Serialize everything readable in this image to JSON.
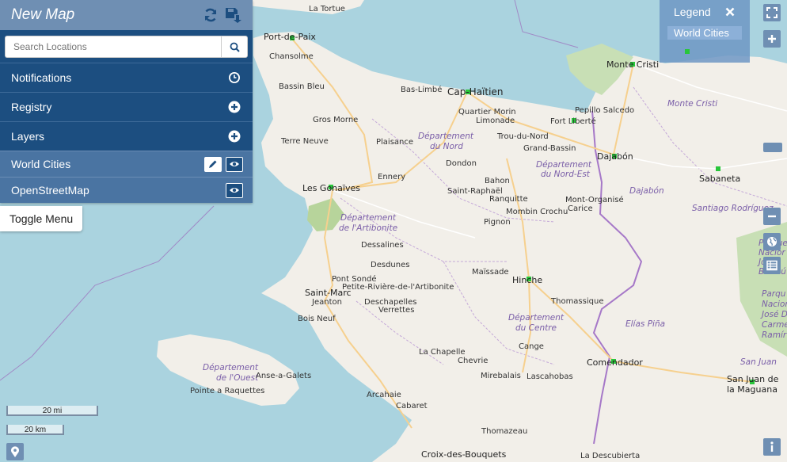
{
  "panel": {
    "title": "New Map",
    "search_placeholder": "Search Locations",
    "menu": [
      {
        "label": "Notifications",
        "icon": "clock-icon"
      },
      {
        "label": "Registry",
        "icon": "plus-circle-icon"
      },
      {
        "label": "Layers",
        "icon": "plus-circle-icon"
      }
    ],
    "layers": [
      {
        "label": "World Cities",
        "icons": [
          "pencil-icon",
          "eye-icon"
        ]
      },
      {
        "label": "OpenStreetMap",
        "icons": [
          "eye-icon"
        ]
      }
    ],
    "toggle_menu": "Toggle Menu"
  },
  "legend": {
    "title": "Legend",
    "layer": "World Cities",
    "swatch_color": "#28c63a"
  },
  "scale": {
    "miles": "20 mi",
    "km": "20 km"
  },
  "colors": {
    "water": "#aad3df",
    "land": "#f2efe9",
    "panel": "#1c4e80",
    "panel_header": "#6f8fb3",
    "layer_row": "#4a74a2",
    "city_marker": "#28c63a"
  },
  "map_labels": {
    "la_tortue": "La Tortue",
    "port_de_paix": "Port-de-Paix",
    "chansolme": "Chansolme",
    "bassin_bleu": "Bassin Bleu",
    "bas_limbe": "Bas-Limbé",
    "cap_haitien": "Cap-Haïtien",
    "monte_cristi_city": "Monte Cristi",
    "monte_cristi_prov": "Monte Cristi",
    "quartier_morin": "Quartier Morin",
    "limonade": "Limonade",
    "pepillo_salcedo": "Pepillo Salcedo",
    "gros_morne": "Gros Morne",
    "dept_nord_1": "Département",
    "dept_nord_2": "du Nord",
    "trou_du_nord": "Trou-du-Nord",
    "fort_liberte": "Fort Liberté",
    "terre_neuve": "Terre Neuve",
    "plaisance": "Plaisance",
    "grand_bassin": "Grand-Bassin",
    "dajabon": "Dajabón",
    "dondon": "Dondon",
    "dept_ne_1": "Département",
    "dept_ne_2": "du Nord-Est",
    "sabaneta": "Sabaneta",
    "ennery": "Ennery",
    "bahon": "Bahon",
    "les_gonaives": "Les Gonaïves",
    "saint_raphael": "Saint-Raphaël",
    "dajabon_prov": "Dajabón",
    "ranquitte": "Ranquitte",
    "mont_organise": "Mont-Organisé",
    "carice": "Carice",
    "mombin_crochu": "Mombin Crochu",
    "santiago_rodriguez": "Santiago Rodríguez",
    "dept_art_1": "Département",
    "dept_art_2": "de l'Artibonite",
    "pignon": "Pignon",
    "dessalines": "Dessalines",
    "desdunes": "Desdunes",
    "maissade": "Maïssade",
    "pont_sonde": "Pont Sondé",
    "petite_riviere": "Petite-Rivière-de-l'Artibonite",
    "hinche": "Hinche",
    "saint_marc": "Saint-Marc",
    "jeanton": "Jeanton",
    "deschapelles": "Deschapelles",
    "verrettes": "Verrettes",
    "thomassique": "Thomassique",
    "bois_neuf": "Bois Neuf",
    "dept_centre_1": "Département",
    "dept_centre_2": "du Centre",
    "elias_pina": "Elías Piña",
    "cange": "Cange",
    "la_chapelle": "La Chapelle",
    "chevrie": "Chevrie",
    "comendador": "Comendador",
    "san_juan": "San Juan",
    "dept_ouest_1": "Département",
    "dept_ouest_2": "de l'Ouest",
    "anse_a_galets": "Anse-a-Galets",
    "mirebalais": "Mirebalais",
    "lascahobas": "Lascahobas",
    "san_juan_city_1": "San Juan de",
    "san_juan_city_2": "la Maguana",
    "pointe_a_raquettes": "Pointe a Raquettes",
    "arcahaie": "Arcahaie",
    "cabaret": "Cabaret",
    "thomazeau": "Thomazeau",
    "croix_des_bouquets": "Croix-des-Bouquets",
    "la_descubierta": "La Descubierta",
    "parque_1": "Parqu",
    "parque_2": "Nacion",
    "parque_3": "José D",
    "parque_4": "Carme",
    "parque_5": "Ramír",
    "parque_b_1": "Parque",
    "parque_b_2": "Nacior",
    "parque_b_3": "José",
    "parque_b_4": "Bermú"
  }
}
